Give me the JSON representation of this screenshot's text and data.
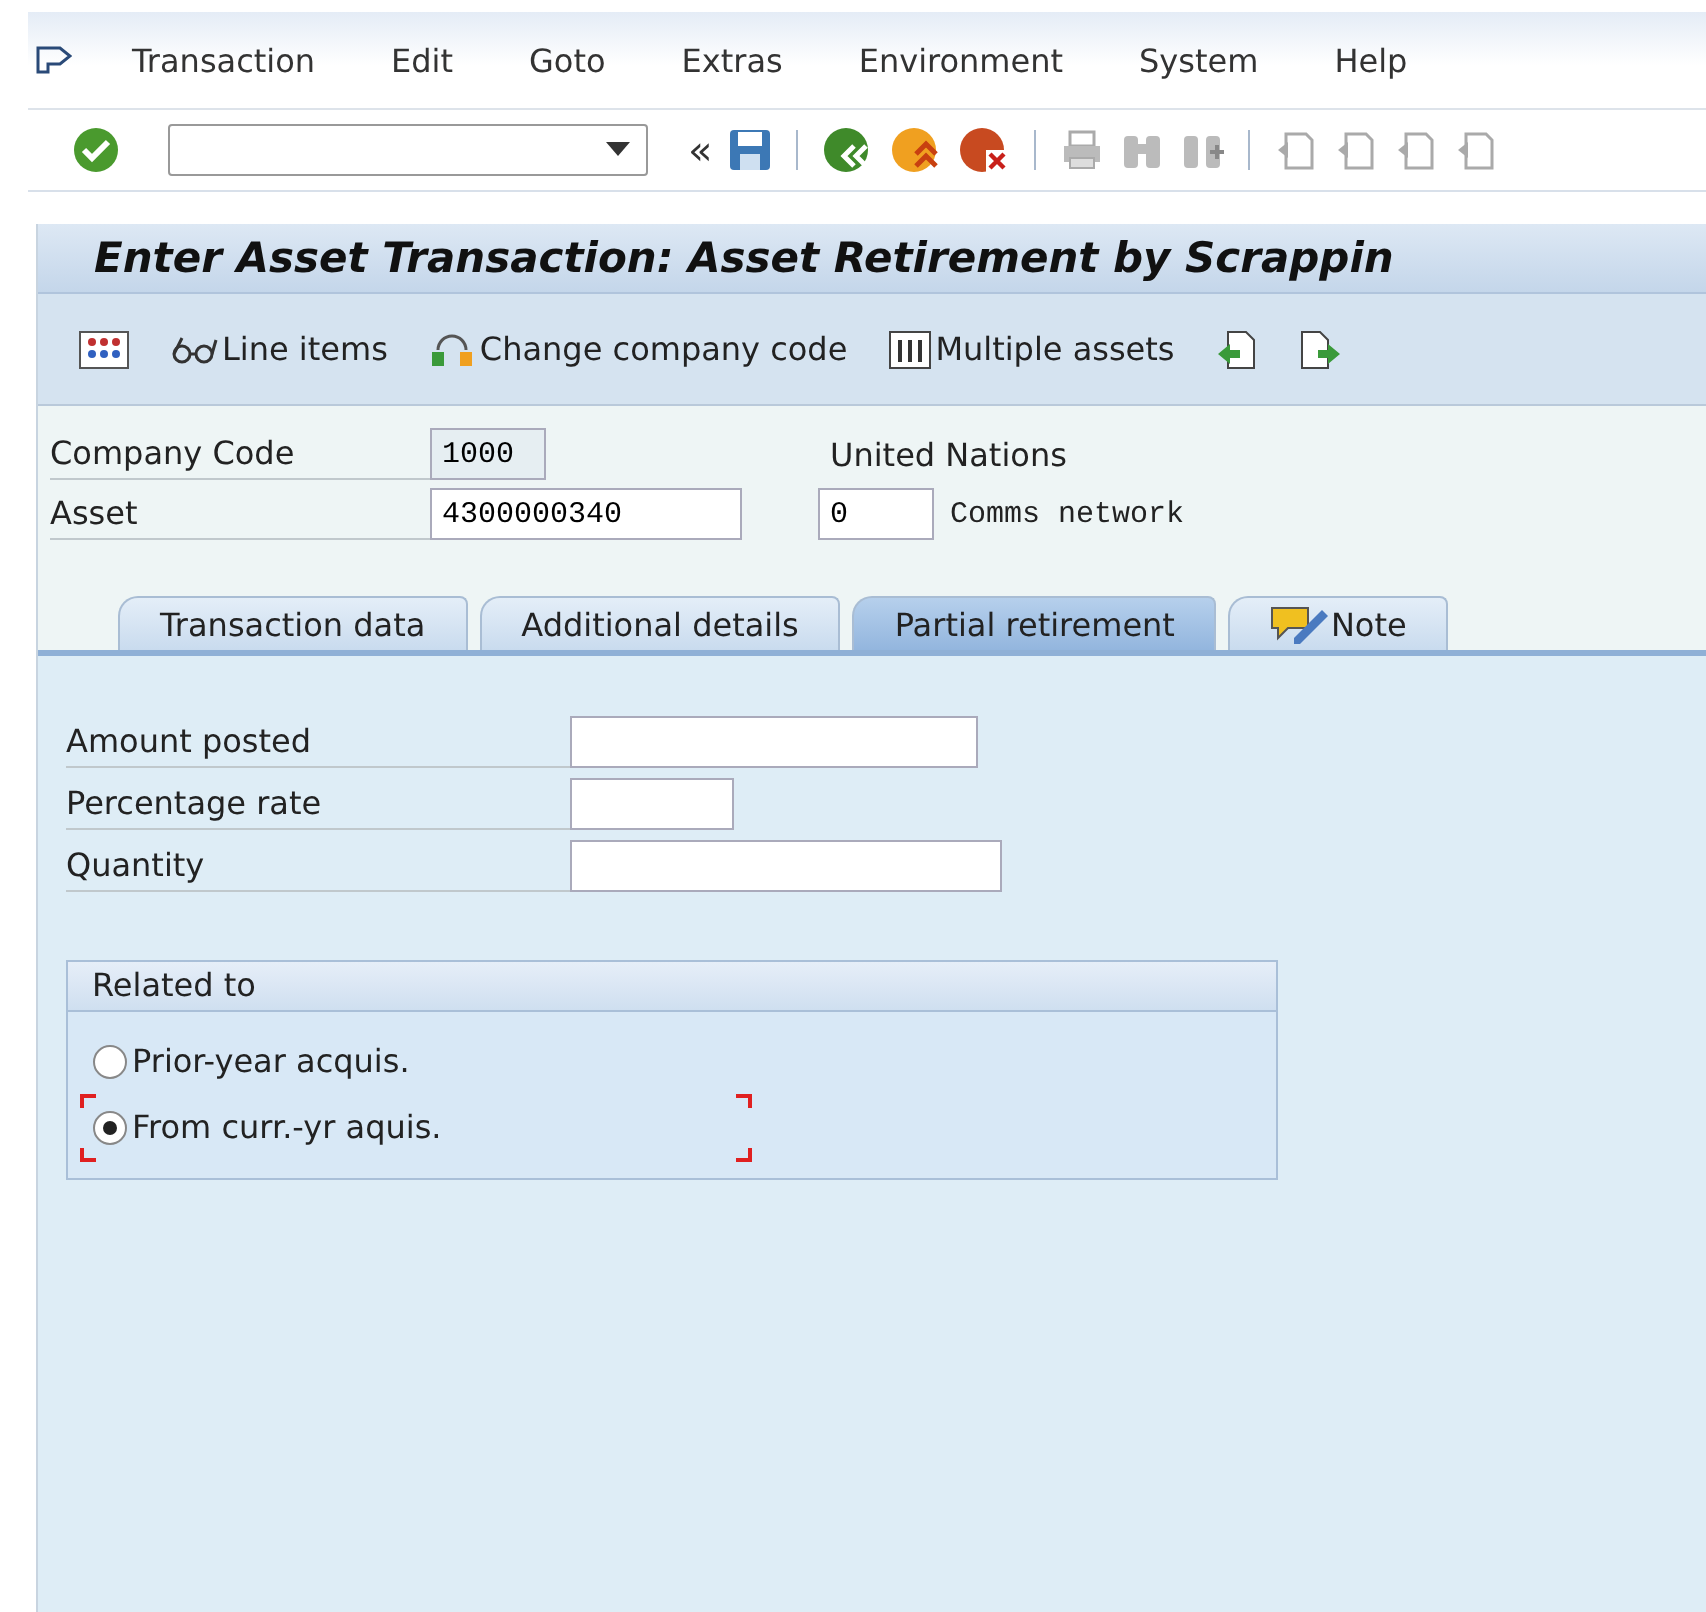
{
  "menu": [
    {
      "label": "Transaction"
    },
    {
      "label": "Edit"
    },
    {
      "label": "Goto"
    },
    {
      "label": "Extras"
    },
    {
      "label": "Environment"
    },
    {
      "label": "System"
    },
    {
      "label": "Help"
    }
  ],
  "collapse_glyph": "«",
  "title": "Enter Asset Transaction: Asset Retirement by Scrappin",
  "app_toolbar": [
    {
      "kind": "abacus"
    },
    {
      "kind": "glasses",
      "label": "Line items"
    },
    {
      "kind": "switch",
      "label": "Change company code"
    },
    {
      "kind": "grid",
      "label": "Multiple assets"
    },
    {
      "kind": "prev"
    },
    {
      "kind": "next"
    }
  ],
  "header": {
    "company_code": {
      "label": "Company Code",
      "value": "1000",
      "description": "United Nations"
    },
    "asset": {
      "label": "Asset",
      "value": "4300000340",
      "sub_number": "0",
      "description": "Comms network"
    }
  },
  "tabs": [
    {
      "label": "Transaction data",
      "selected": false,
      "icon": false
    },
    {
      "label": "Additional details",
      "selected": false,
      "icon": false
    },
    {
      "label": "Partial retirement",
      "selected": true,
      "icon": false
    },
    {
      "label": "Note",
      "selected": false,
      "icon": true
    }
  ],
  "fields": [
    {
      "label": "Amount posted"
    },
    {
      "label": "Percentage rate"
    },
    {
      "label": "Quantity"
    }
  ],
  "group": {
    "title": "Related to",
    "options": [
      {
        "label": "Prior-year acquis.",
        "selected": false,
        "focused": false
      },
      {
        "label": "From curr.-yr aquis.",
        "selected": true,
        "focused": true
      }
    ]
  }
}
